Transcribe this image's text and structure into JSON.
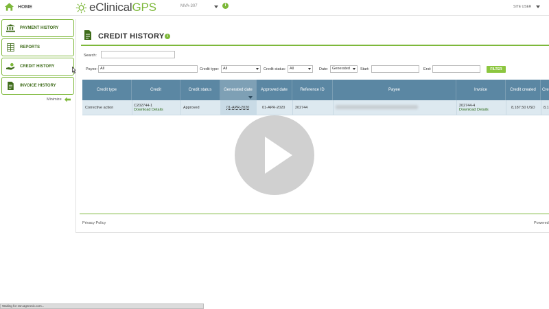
{
  "topbar": {
    "home_label": "HOME",
    "logo_e": "eClinical",
    "logo_gps": "GPS",
    "study_code": "MVA-307",
    "user_label": "SITE USER"
  },
  "sidebar": {
    "items": [
      {
        "label": "PAYMENT HISTORY"
      },
      {
        "label": "REPORTS"
      },
      {
        "label": "CREDIT HISTORY"
      },
      {
        "label": "INVOICE HISTORY"
      }
    ],
    "minimize_label": "Minimize"
  },
  "page": {
    "title": "CREDIT HISTORY"
  },
  "filters": {
    "search_label": "Search:",
    "search_value": "",
    "payee_label": "Payee:",
    "payee_value": "All",
    "credit_type_label": "Credit type:",
    "credit_type_value": "All",
    "credit_status_label": "Credit status:",
    "credit_status_value": "All",
    "date_label": "Date:",
    "date_value": "Generated",
    "start_label": "Start:",
    "start_value": "",
    "end_label": "End:",
    "end_value": "",
    "filter_button": "FILTER"
  },
  "table": {
    "headers": [
      "Credit type",
      "Credit",
      "Credit status",
      "Generated date",
      "Approved date",
      "Reference ID",
      "Payee",
      "Invoice",
      "Credit created",
      "Cre"
    ],
    "rows": [
      {
        "credit_type": "Corrective action",
        "credit_id": "C202744-1",
        "credit_link": "Download Details",
        "status": "Approved",
        "generated": "01-APR-2020",
        "approved": "01-APR-2020",
        "reference": "202744",
        "invoice_id": "202744-4",
        "invoice_link": "Download Details",
        "created": "8,187.50 USD",
        "extra": "8,1"
      }
    ]
  },
  "footer": {
    "privacy": "Privacy Policy",
    "powered": "Powered"
  },
  "statusbar": {
    "text": "Waiting for ssn.agnrosic.com..."
  }
}
